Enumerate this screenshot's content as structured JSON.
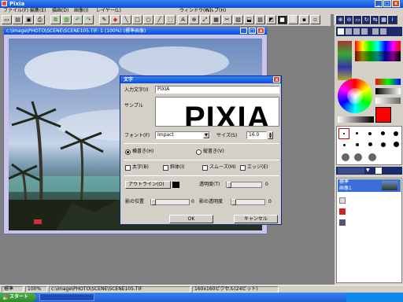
{
  "app": {
    "title": "Pixia",
    "icon_name": "pixia-app-icon"
  },
  "menu": [
    "ファイル(F)",
    "編集(E)",
    "描画(D)",
    "画像(I)",
    "レイヤー(L)",
    "ウィンドウ(W)",
    "ヘルプ(H)"
  ],
  "toolbar": {
    "icons": [
      "new-icon",
      "open-icon",
      "save-icon",
      "print-icon",
      "copy-icon",
      "paste-icon",
      "undo-icon",
      "redo-icon",
      "pen-icon",
      "eraser-icon",
      "line-icon",
      "rect-icon",
      "ellipse-icon",
      "fill-icon",
      "select-icon",
      "text-icon",
      "zoom-icon",
      "scale-icon"
    ]
  },
  "right_toolbar": {
    "icons": [
      "zoom-in-icon",
      "zoom-out-icon",
      "fit-icon",
      "rotate-icon",
      "flip-icon",
      "grid-icon",
      "info-icon",
      "help-icon"
    ]
  },
  "image_window": {
    "title": "c:\\image\\PHOTO\\SCENE\\SCENE105.TIF: 1 (100%) (標準画像)"
  },
  "dialog": {
    "title": "文字",
    "input_label": "入力文字(I)",
    "input_value": "PIXIA",
    "sample_label": "サンプル",
    "sample_text": "PIXIA",
    "font_label": "フォント(F)",
    "font_value": "Impact",
    "size_label": "サイズ(S)",
    "size_value": "16.0",
    "horizontal_label": "横書き(H)",
    "vertical_label": "縦書き(V)",
    "options": [
      "太字(B)",
      "斜体(I)",
      "スムーズ(M)",
      "エッジ(E)"
    ],
    "outline_button": "アウトライン(O)",
    "outline_value": "0",
    "opacity_label": "透明度(T)",
    "opacity_value": "0",
    "shadow_label": "影の位置",
    "shadow_value": "0",
    "shadow_opacity_label": "影の透明度",
    "shadow_opacity_value": "0",
    "ok_label": "OK",
    "cancel_label": "キャンセル"
  },
  "palette": {
    "accent": "#0a4fd3",
    "fg_color": "#ff0000",
    "bg_color": "#ffffff"
  },
  "layer_panel": {
    "layer_name": "標準",
    "layer_sub": "画像1"
  },
  "statusbar": {
    "mode": "標準",
    "zoom": "100%",
    "path": "c:\\image\\PHOTO\\SCENE\\SCENE105.TIF",
    "size": "160x160ピクセル(24ビット)"
  },
  "taskbar": {
    "start_label": "スタート"
  }
}
